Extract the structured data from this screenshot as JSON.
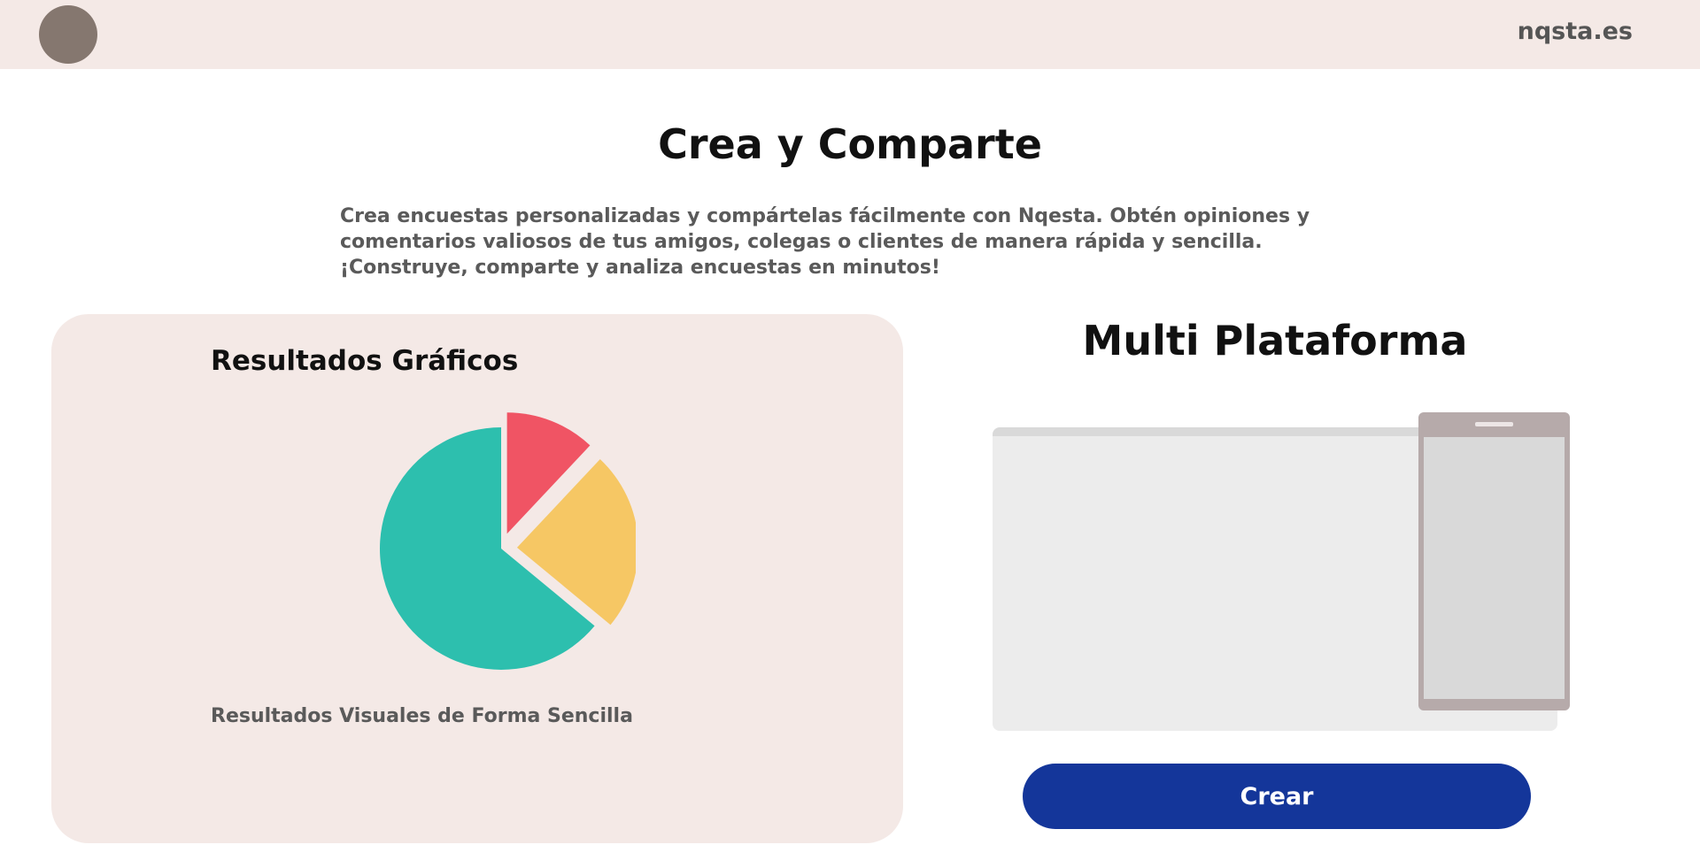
{
  "header": {
    "brand": "nqsta.es"
  },
  "hero": {
    "title": "Crea y Comparte",
    "description": "Crea encuestas personalizadas y compártelas fácilmente con Nqesta. Obtén opiniones y comentarios valiosos de tus amigos, colegas o clientes de manera rápida y sencilla. ¡Construye, comparte y analiza encuestas en minutos!"
  },
  "feature_card": {
    "title": "Resultados Gráficos",
    "caption": "Resultados Visuales de Forma Sencilla"
  },
  "chart_data": {
    "type": "pie",
    "values": [
      12,
      24,
      64
    ],
    "colors": [
      "#f05464",
      "#f6c764",
      "#2dbfae"
    ],
    "exploded": true
  },
  "multi_platform": {
    "title": "Multi Plataforma"
  },
  "actions": {
    "create_label": "Crear"
  },
  "colors": {
    "topbar_bg": "#f4e9e6",
    "avatar": "#85776f",
    "card_bg": "#f4e9e6",
    "button_bg": "#14369a",
    "monitor_bg": "#ececec",
    "phone_frame": "#b6aaaa"
  }
}
